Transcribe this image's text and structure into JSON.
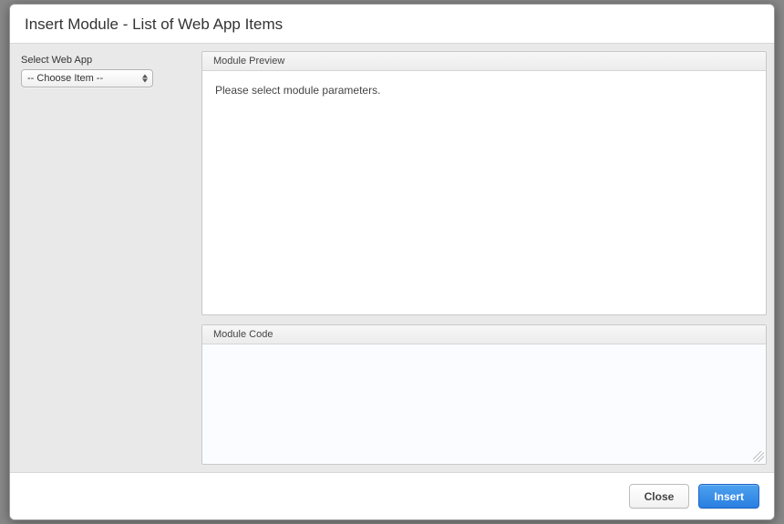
{
  "modal": {
    "title": "Insert Module - List of Web App Items"
  },
  "sidebar": {
    "select_label": "Select Web App",
    "select_value": "-- Choose Item --"
  },
  "preview": {
    "header": "Module Preview",
    "message": "Please select module parameters."
  },
  "code": {
    "header": "Module Code",
    "value": ""
  },
  "footer": {
    "close_label": "Close",
    "insert_label": "Insert"
  }
}
